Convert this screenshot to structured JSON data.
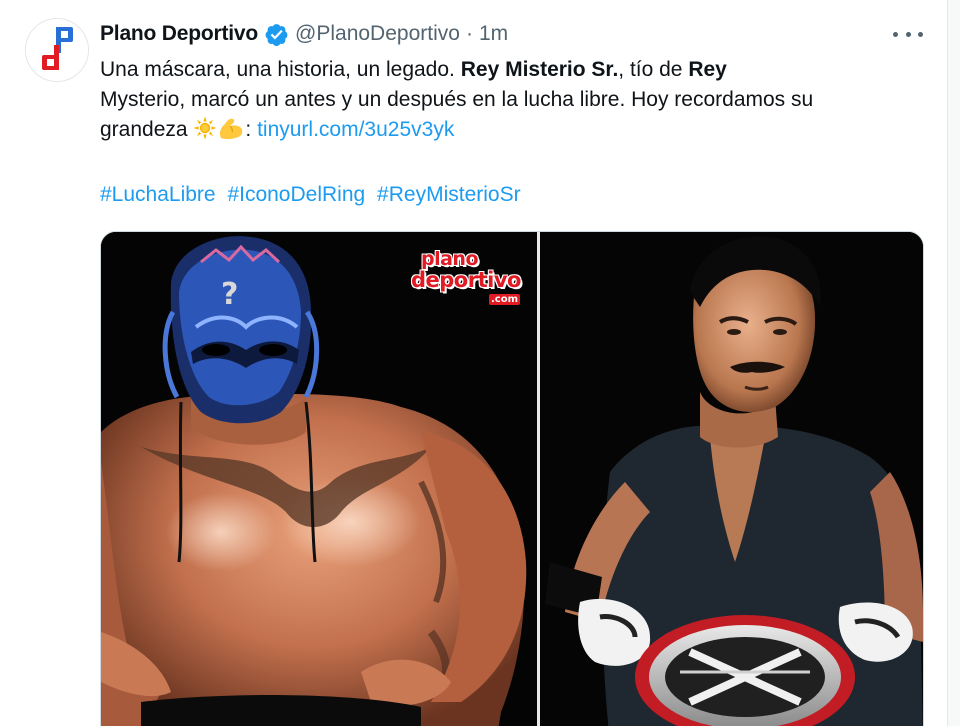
{
  "tweet": {
    "author_name": "Plano Deportivo",
    "handle": "@PlanoDeportivo",
    "separator": "·",
    "time": "1m",
    "text": {
      "p1": "Una máscara, una historia, un legado. ",
      "b1": "Rey Misterio Sr.",
      "p2": ", tío de ",
      "b2": "Rey",
      "p3": "Mysterio, marcó un antes y un después en la lucha libre. Hoy recordamos su grandeza ",
      "p4": ": ",
      "link": "tinyurl.com/3u25v3yk"
    },
    "hashtags": [
      "#LuchaLibre",
      "#IconoDelRing",
      "#ReyMisterioSr"
    ],
    "emoji": [
      "sun-emoji",
      "flexed-biceps-emoji"
    ]
  },
  "media": {
    "watermark": {
      "line1": "plano",
      "line2": "deportivo",
      "line3": ".com"
    },
    "left_image": "masked-wrestler-photo",
    "right_image": "wrestler-with-belt-photo"
  },
  "icons": {
    "avatar": "plano-deportivo-logo-avatar",
    "verified": "verified-badge-icon",
    "more": "more-options-icon"
  },
  "colors": {
    "link": "#1d9bf0",
    "text": "#0f1419",
    "secondary": "#536471",
    "brand_red": "#e01b24",
    "brand_blue": "#2a6fd6"
  }
}
